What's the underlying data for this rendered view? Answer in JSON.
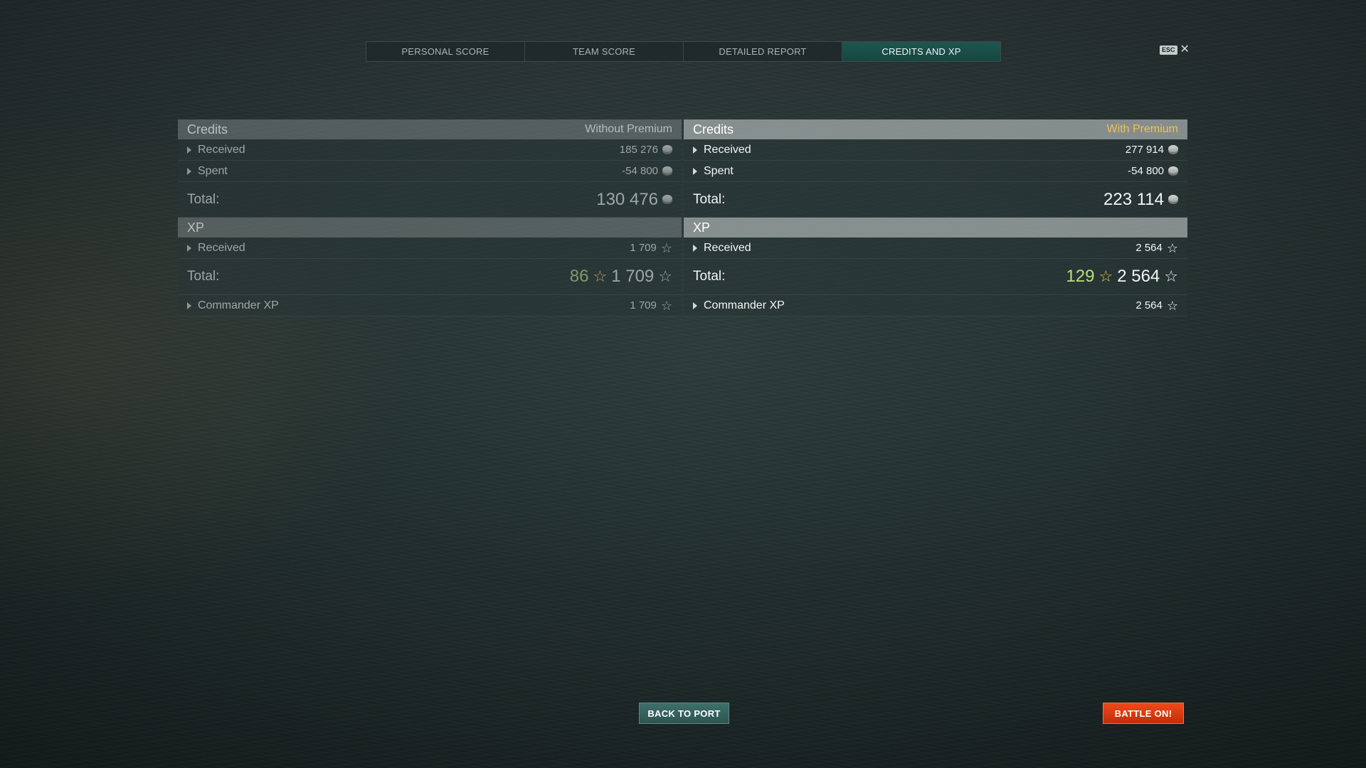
{
  "tabs": [
    {
      "label": "PERSONAL SCORE",
      "active": false
    },
    {
      "label": "TEAM SCORE",
      "active": false
    },
    {
      "label": "DETAILED REPORT",
      "active": false
    },
    {
      "label": "CREDITS AND XP",
      "active": true
    }
  ],
  "esc": {
    "key": "ESC",
    "close": "✕"
  },
  "without_premium": {
    "credits_title": "Credits",
    "premium_label": "Without Premium",
    "received_label": "Received",
    "received_value": "185 276",
    "spent_label": "Spent",
    "spent_value": "-54 800",
    "total_label": "Total:",
    "total_value": "130 476",
    "xp_title": "XP",
    "xp_received_label": "Received",
    "xp_received_value": "1 709",
    "xp_total_label": "Total:",
    "xp_bonus_value": "86",
    "xp_total_value": "1 709",
    "commander_label": "Commander XP",
    "commander_value": "1 709"
  },
  "with_premium": {
    "credits_title": "Credits",
    "premium_label": "With Premium",
    "received_label": "Received",
    "received_value": "277 914",
    "spent_label": "Spent",
    "spent_value": "-54 800",
    "total_label": "Total:",
    "total_value": "223 114",
    "xp_title": "XP",
    "xp_received_label": "Received",
    "xp_received_value": "2 564",
    "xp_total_label": "Total:",
    "xp_bonus_value": "129",
    "xp_total_value": "2 564",
    "commander_label": "Commander XP",
    "commander_value": "2 564"
  },
  "icons": {
    "credits": "credit-coin-icon",
    "xp": "star-icon",
    "expand": "caret-right-icon"
  },
  "buttons": {
    "back_to_port": "BACK TO PORT",
    "battle_on": "BATTLE ON!"
  },
  "colors": {
    "active_tab": "#1e5650",
    "premium_gold": "#f2c14e",
    "bonus_green": "#b8e07a",
    "battle_button": "#e03a10"
  }
}
